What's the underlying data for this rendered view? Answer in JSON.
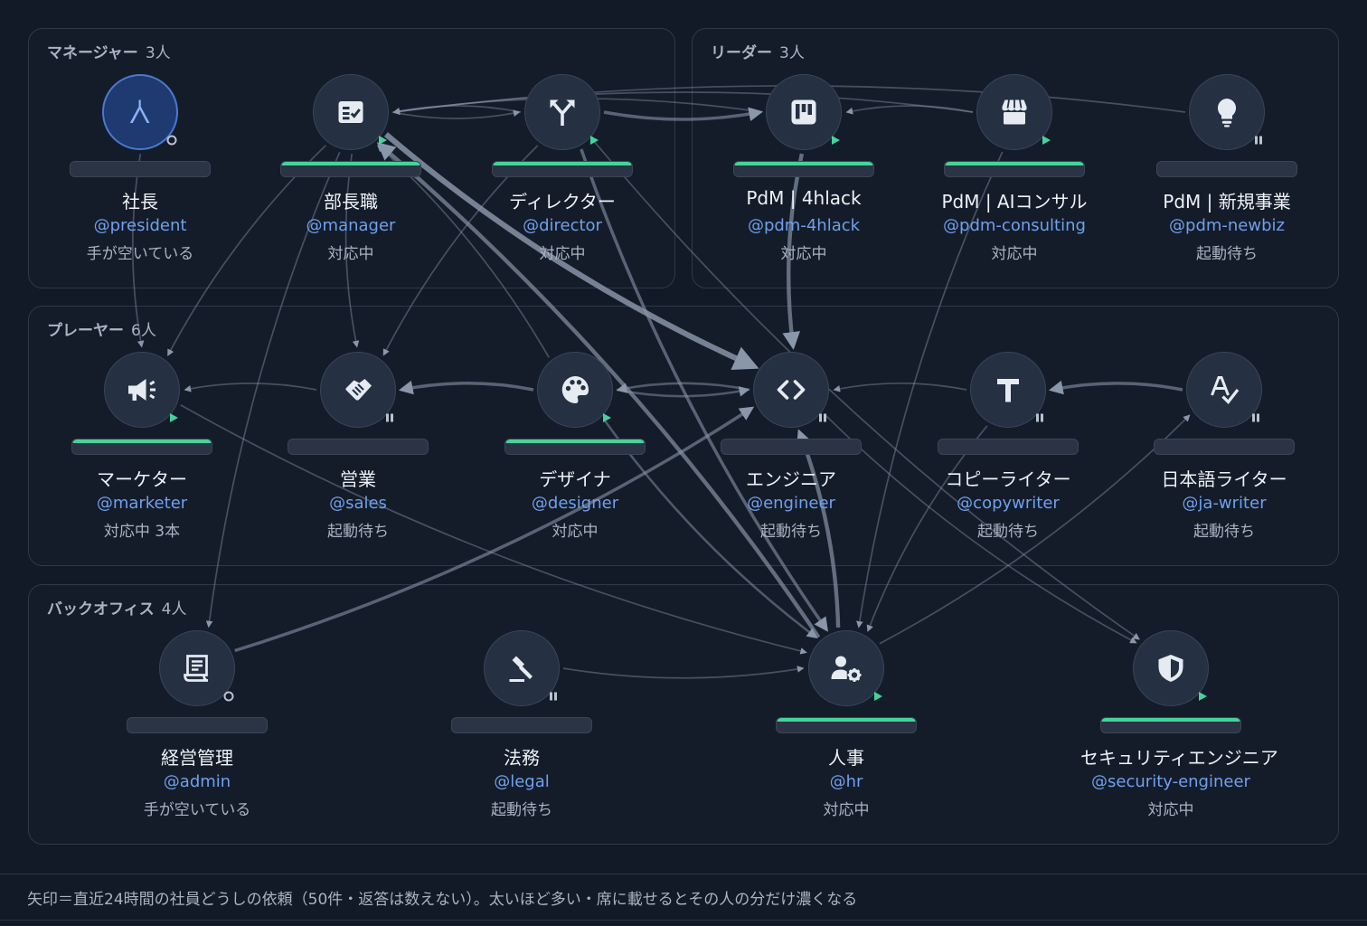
{
  "sections": [
    {
      "id": "managers",
      "title": "マネージャー",
      "count": "3人"
    },
    {
      "id": "leaders",
      "title": "リーダー",
      "count": "3人"
    },
    {
      "id": "players",
      "title": "プレーヤー",
      "count": "6人"
    },
    {
      "id": "backoffice",
      "title": "バックオフィス",
      "count": "4人"
    }
  ],
  "nodes": [
    {
      "id": "president",
      "name": "社長",
      "handle": "@president",
      "status": "手が空いている",
      "icon": "person-icon",
      "state": "idle",
      "activity": 0
    },
    {
      "id": "manager",
      "name": "部長職",
      "handle": "@manager",
      "status": "対応中",
      "icon": "checklist-icon",
      "state": "running",
      "activity": 1
    },
    {
      "id": "director",
      "name": "ディレクター",
      "handle": "@director",
      "status": "対応中",
      "icon": "fork-arrows-icon",
      "state": "running",
      "activity": 1
    },
    {
      "id": "pdm-4hlack",
      "name": "PdM | 4hlack",
      "handle": "@pdm-4hlack",
      "status": "対応中",
      "icon": "kanban-icon",
      "state": "running",
      "activity": 1
    },
    {
      "id": "pdm-consulting",
      "name": "PdM | AIコンサル",
      "handle": "@pdm-consulting",
      "status": "対応中",
      "icon": "storefront-icon",
      "state": "running",
      "activity": 1
    },
    {
      "id": "pdm-newbiz",
      "name": "PdM | 新規事業",
      "handle": "@pdm-newbiz",
      "status": "起動待ち",
      "icon": "lightbulb-icon",
      "state": "paused",
      "activity": 0
    },
    {
      "id": "marketer",
      "name": "マーケター",
      "handle": "@marketer",
      "status": "対応中 3本",
      "icon": "megaphone-icon",
      "state": "running",
      "activity": 1
    },
    {
      "id": "sales",
      "name": "営業",
      "handle": "@sales",
      "status": "起動待ち",
      "icon": "handshake-icon",
      "state": "paused",
      "activity": 0
    },
    {
      "id": "designer",
      "name": "デザイナ",
      "handle": "@designer",
      "status": "対応中",
      "icon": "palette-icon",
      "state": "running",
      "activity": 1
    },
    {
      "id": "engineer",
      "name": "エンジニア",
      "handle": "@engineer",
      "status": "起動待ち",
      "icon": "code-icon",
      "state": "paused",
      "activity": 0
    },
    {
      "id": "copywriter",
      "name": "コピーライター",
      "handle": "@copywriter",
      "status": "起動待ち",
      "icon": "text-icon",
      "state": "paused",
      "activity": 0
    },
    {
      "id": "ja-writer",
      "name": "日本語ライター",
      "handle": "@ja-writer",
      "status": "起動待ち",
      "icon": "spellcheck-icon",
      "state": "paused",
      "activity": 0
    },
    {
      "id": "admin",
      "name": "経営管理",
      "handle": "@admin",
      "status": "手が空いている",
      "icon": "receipt-icon",
      "state": "idle",
      "activity": 0
    },
    {
      "id": "legal",
      "name": "法務",
      "handle": "@legal",
      "status": "起動待ち",
      "icon": "gavel-icon",
      "state": "paused",
      "activity": 0
    },
    {
      "id": "hr",
      "name": "人事",
      "handle": "@hr",
      "status": "対応中",
      "icon": "person-gear-icon",
      "state": "running",
      "activity": 1
    },
    {
      "id": "security-engineer",
      "name": "セキュリティエンジニア",
      "handle": "@security-engineer",
      "status": "対応中",
      "icon": "shield-icon",
      "state": "running",
      "activity": 1
    }
  ],
  "edges": [
    {
      "from": "manager",
      "to": "engineer",
      "weight": 6
    },
    {
      "from": "hr",
      "to": "manager",
      "weight": 4
    },
    {
      "from": "hr",
      "to": "engineer",
      "weight": 4
    },
    {
      "from": "pdm-4hlack",
      "to": "engineer",
      "weight": 4
    },
    {
      "from": "director",
      "to": "pdm-4hlack",
      "weight": 3
    },
    {
      "from": "ja-writer",
      "to": "copywriter",
      "weight": 3
    },
    {
      "from": "admin",
      "to": "engineer",
      "weight": 3
    },
    {
      "from": "designer",
      "to": "sales",
      "weight": 3
    },
    {
      "from": "director",
      "to": "hr",
      "weight": 3
    },
    {
      "from": "designer",
      "to": "engineer",
      "weight": 2
    },
    {
      "from": "designer",
      "to": "hr",
      "weight": 2
    },
    {
      "from": "engineer",
      "to": "designer",
      "weight": 2
    },
    {
      "from": "director",
      "to": "manager",
      "weight": 1
    },
    {
      "from": "manager",
      "to": "director",
      "weight": 1
    },
    {
      "from": "pdm-consulting",
      "to": "pdm-4hlack",
      "weight": 1
    },
    {
      "from": "copywriter",
      "to": "engineer",
      "weight": 1
    },
    {
      "from": "manager",
      "to": "sales",
      "weight": 1
    },
    {
      "from": "director",
      "to": "sales",
      "weight": 1
    },
    {
      "from": "sales",
      "to": "marketer",
      "weight": 1
    },
    {
      "from": "president",
      "to": "marketer",
      "weight": 1
    },
    {
      "from": "manager",
      "to": "admin",
      "weight": 1
    },
    {
      "from": "engineer",
      "to": "security-engineer",
      "weight": 1
    },
    {
      "from": "pdm-newbiz",
      "to": "manager",
      "weight": 1
    },
    {
      "from": "pdm-consulting",
      "to": "manager",
      "weight": 1
    },
    {
      "from": "pdm-4hlack",
      "to": "manager",
      "weight": 1
    },
    {
      "from": "hr",
      "to": "ja-writer",
      "weight": 1
    },
    {
      "from": "marketer",
      "to": "hr",
      "weight": 1
    },
    {
      "from": "director",
      "to": "security-engineer",
      "weight": 1
    },
    {
      "from": "legal",
      "to": "hr",
      "weight": 1
    },
    {
      "from": "manager",
      "to": "marketer",
      "weight": 1
    },
    {
      "from": "designer",
      "to": "manager",
      "weight": 1
    },
    {
      "from": "copywriter",
      "to": "hr",
      "weight": 1
    },
    {
      "from": "pdm-consulting",
      "to": "hr",
      "weight": 1
    }
  ],
  "colors": {
    "running": "#46d39a",
    "paused": "#b9c2cf",
    "idle": "#b9c2cf",
    "handle": "#6fa0ec",
    "edge": "#8a96aa"
  },
  "footer": {
    "note": "矢印＝直近24時間の社員どうしの依頼（50件・返答は数えない）。太いほど多い・席に載せるとその人の分だけ濃くなる"
  }
}
